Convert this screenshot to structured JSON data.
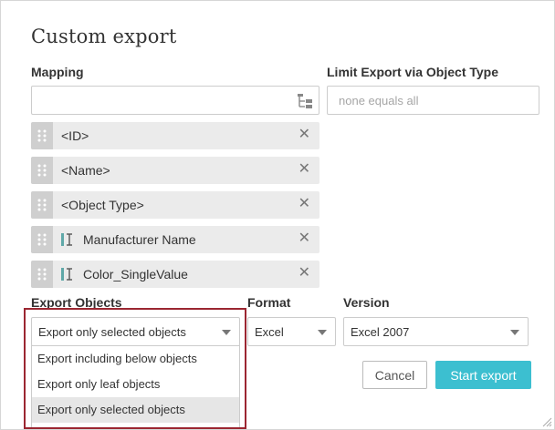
{
  "dialog": {
    "title": "Custom export"
  },
  "mapping": {
    "label": "Mapping",
    "input_value": "",
    "items": [
      {
        "label": "<ID>",
        "attribute": false
      },
      {
        "label": "<Name>",
        "attribute": false
      },
      {
        "label": "<Object Type>",
        "attribute": false
      },
      {
        "label": "Manufacturer Name",
        "attribute": true
      },
      {
        "label": "Color_SingleValue",
        "attribute": true
      }
    ],
    "remove_glyph": "✕"
  },
  "limit": {
    "label": "Limit Export via Object Type",
    "placeholder": "none equals all"
  },
  "export_objects": {
    "label": "Export Objects",
    "selected": "Export only selected objects",
    "options": [
      "Export including below objects",
      "Export only leaf objects",
      "Export only selected objects"
    ]
  },
  "format": {
    "label": "Format",
    "selected": "Excel"
  },
  "version": {
    "label": "Version",
    "selected": "Excel 2007"
  },
  "buttons": {
    "cancel": "Cancel",
    "start_export": "Start export"
  },
  "colors": {
    "accent": "#3cbfd0",
    "highlight": "#9b2631"
  },
  "icons": {
    "tree": "tree-structure-icon",
    "drag": "drag-handle-icon",
    "attribute": "attribute-icon",
    "resize": "resize-grip-icon"
  }
}
